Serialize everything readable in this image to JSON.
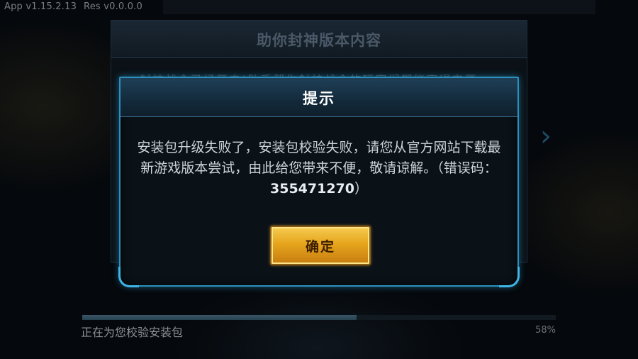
{
  "version": {
    "app": "App v1.15.2.13",
    "res": "Res v0.0.0.0"
  },
  "background_panel": {
    "title": "助你封神版本内容",
    "partial_text": "封神战令已经开启!助手帮你封神战令的玩家们都能享得丰厚"
  },
  "dialog": {
    "title": "提示",
    "message": "安装包升级失败了，安装包校验失败，请您从官方网站下载最新游戏版本尝试，由此给您带来不便，敬请谅解。（错误码：",
    "error_code": "355471270",
    "message_end": "）",
    "confirm_label": "确定"
  },
  "status": {
    "text": "正在为您校验安装包",
    "percent_label": "58%",
    "progress": 0.58
  },
  "colors": {
    "accent": "#2a90bd",
    "button": "#e6a51c"
  }
}
